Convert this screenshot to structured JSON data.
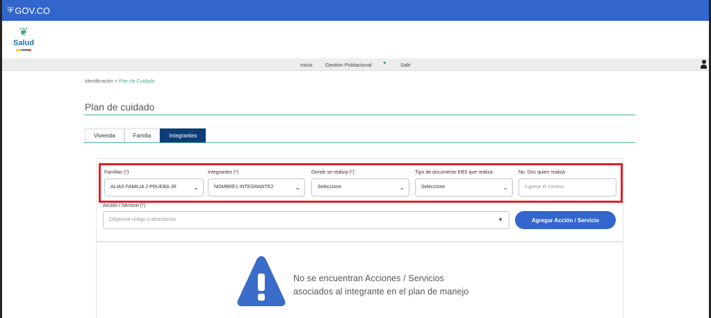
{
  "gov_bar": {
    "brand": "GOV.CO",
    "shield_glyph": "⛨"
  },
  "logo": {
    "text": "Salud",
    "leaf_glyph": "❦"
  },
  "menu": {
    "items": [
      {
        "label": "Inicio"
      },
      {
        "label": "Gestión Poblacional"
      },
      {
        "label": "Salir"
      }
    ],
    "caret": "▼"
  },
  "breadcrumb": {
    "root": "Identificación",
    "separator": ">",
    "current": "Plan de Cuidado"
  },
  "page": {
    "title": "Plan de cuidado"
  },
  "tabs": [
    {
      "label": "Vivienda",
      "active": false
    },
    {
      "label": "Familia",
      "active": false
    },
    {
      "label": "Integrantes",
      "active": true
    }
  ],
  "form": {
    "familias": {
      "label": "Familias (*)",
      "value": "ALIAS FAMILIA 2 PRUEBA JR"
    },
    "integrantes": {
      "label": "Integrantes (*)",
      "value": "NOMBRE1 INTEGRANTE2"
    },
    "donde": {
      "label": "Donde se realiza (*)",
      "value": "Seleccione"
    },
    "tipo_doc": {
      "label": "Tipo de documento EBS que realiza",
      "value": "Seleccione"
    },
    "no_doc": {
      "label": "No. Doc quien realiza",
      "placeholder": "Ingrese el número"
    },
    "accion": {
      "label": "Acción / Servicio (*)",
      "placeholder": "Diligencie código o descripción"
    },
    "add_button": "Agregar Acción / Servicio",
    "chevron": "⌄"
  },
  "empty_state": {
    "line1": "No se encuentran Acciones / Servicios",
    "line2": "asociados al integrante en el plan de manejo"
  },
  "colors": {
    "gov_blue": "#3366cc",
    "tab_active": "#0b3d78",
    "accent_teal": "#4aa89a",
    "highlight_red": "#e41e24",
    "warning_blue": "#3a6cc9"
  }
}
